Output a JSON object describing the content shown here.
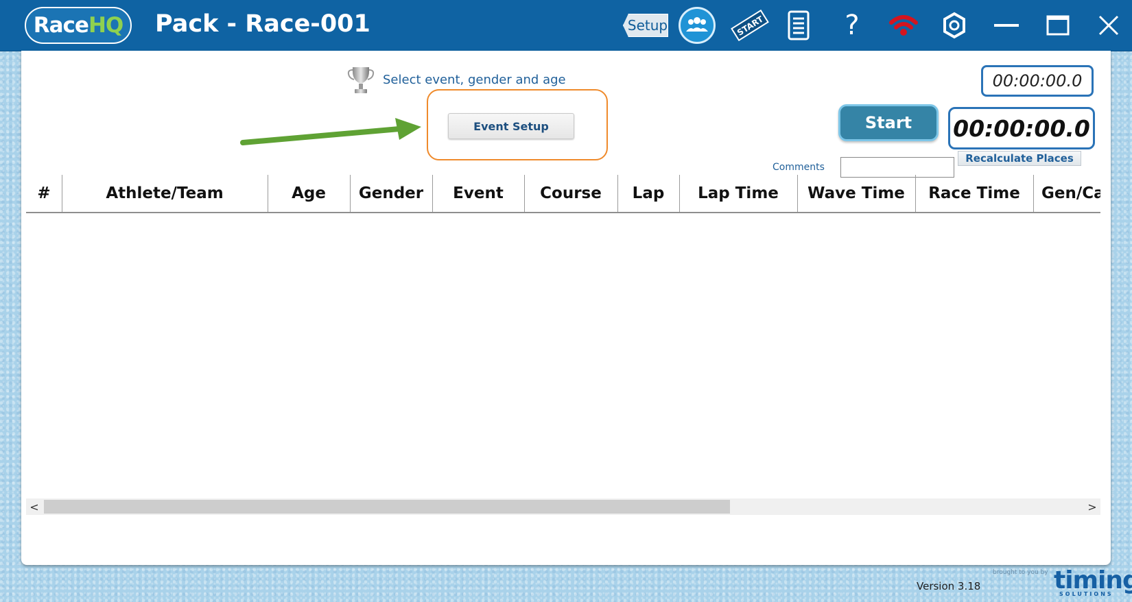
{
  "app": {
    "logo_race": "Race",
    "logo_hq": "HQ",
    "title": "Pack - Race-001"
  },
  "toolbar": {
    "setup_label": "Setup",
    "start_tag_label": "START",
    "help_glyph": "?",
    "icons": [
      "setup-tag-icon",
      "team-icon",
      "start-flag-icon",
      "document-icon",
      "help-icon",
      "wifi-icon",
      "settings-icon",
      "minimize-icon",
      "maximize-icon",
      "close-icon"
    ]
  },
  "colors": {
    "titlebar": "#0f63a3",
    "accent_green": "#8fd14f",
    "highlight_orange": "#ef8a2b",
    "arrow_green": "#5fa234",
    "timer_border": "#2a73b7",
    "start_button": "#3584a6",
    "wifi_red": "#d4141f"
  },
  "event": {
    "hint": "Select event, gender and age",
    "setup_button": "Event Setup"
  },
  "timing": {
    "small_timer": "00:00:00.0",
    "main_timer": "00:00:00.0",
    "start_button": "Start",
    "recalc_button": "Recalculate Places",
    "comments_label": "Comments",
    "comments_value": ""
  },
  "table": {
    "columns": [
      "#",
      "Athlete/Team",
      "Age",
      "Gender",
      "Event",
      "Course",
      "Lap",
      "Lap Time",
      "Wave Time",
      "Race Time",
      "Gen/Ca"
    ],
    "rows": []
  },
  "scrollbar": {
    "left_arrow": "<",
    "right_arrow": ">"
  },
  "footer": {
    "version": "Version 3.18",
    "brought_by": "brought to you by",
    "timing_logo": "timing",
    "timing_sub": "SOLUTIONS"
  }
}
